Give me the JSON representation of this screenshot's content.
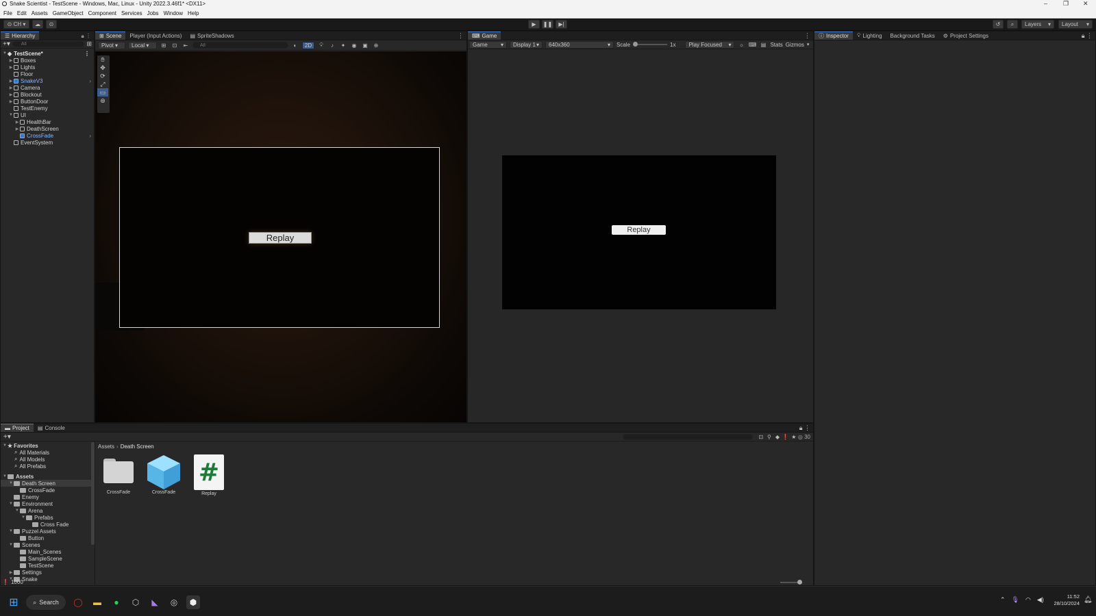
{
  "window": {
    "title": "Snake Scientist - TestScene - Windows, Mac, Linux - Unity 2022.3.46f1* <DX11>"
  },
  "menu": [
    "File",
    "Edit",
    "Assets",
    "GameObject",
    "Component",
    "Services",
    "Jobs",
    "Window",
    "Help"
  ],
  "toolbar": {
    "account": "CH",
    "layers": "Layers",
    "layout": "Layout"
  },
  "hierarchy": {
    "tab": "Hierarchy",
    "search_placeholder": "All",
    "scene": "TestScene*",
    "items": [
      {
        "label": "Boxes",
        "depth": 1,
        "arrow": "▶",
        "selected": false
      },
      {
        "label": "Lights",
        "depth": 1,
        "arrow": "▶",
        "selected": false
      },
      {
        "label": "Floor",
        "depth": 1,
        "arrow": "",
        "selected": false
      },
      {
        "label": "SnakeV3",
        "depth": 1,
        "arrow": "▶",
        "selected": true
      },
      {
        "label": "Camera",
        "depth": 1,
        "arrow": "▶",
        "selected": false
      },
      {
        "label": "Blockout",
        "depth": 1,
        "arrow": "▶",
        "selected": false
      },
      {
        "label": "ButtonDoor",
        "depth": 1,
        "arrow": "▶",
        "selected": false
      },
      {
        "label": "TestEnemy",
        "depth": 1,
        "arrow": "",
        "selected": false
      },
      {
        "label": "UI",
        "depth": 1,
        "arrow": "▼",
        "selected": false
      },
      {
        "label": "HealthBar",
        "depth": 2,
        "arrow": "▶",
        "selected": false
      },
      {
        "label": "DeathScreen",
        "depth": 2,
        "arrow": "▶",
        "selected": false
      },
      {
        "label": "CrossFade",
        "depth": 2,
        "arrow": "",
        "selected": true
      },
      {
        "label": "EventSystem",
        "depth": 1,
        "arrow": "",
        "selected": false
      }
    ]
  },
  "scene_view": {
    "tabs": [
      "Scene",
      "Player (Input Actions)",
      "SpriteShadows"
    ],
    "pivot": "Pivot",
    "local": "Local",
    "search_placeholder": "All",
    "mode_2d": "2D",
    "replay_label": "Replay"
  },
  "game_view": {
    "tab": "Game",
    "mode": "Game",
    "display": "Display 1",
    "resolution": "640x360",
    "scale_label": "Scale",
    "scale_value": "1x",
    "play_mode": "Play Focused",
    "stats": "Stats",
    "gizmos": "Gizmos",
    "replay_label": "Replay"
  },
  "inspector": {
    "tabs": [
      "Inspector",
      "Lighting",
      "Background Tasks",
      "Project Settings"
    ]
  },
  "project": {
    "tabs": [
      "Project",
      "Console"
    ],
    "favorites_title": "Favorites",
    "favorites": [
      "All Materials",
      "All Models",
      "All Prefabs"
    ],
    "assets_title": "Assets",
    "tree": [
      {
        "label": "Death Screen",
        "depth": 1,
        "arrow": "▼"
      },
      {
        "label": "CrossFade",
        "depth": 2,
        "arrow": ""
      },
      {
        "label": "Enemy",
        "depth": 1,
        "arrow": ""
      },
      {
        "label": "Environment",
        "depth": 1,
        "arrow": "▼"
      },
      {
        "label": "Arena",
        "depth": 2,
        "arrow": "▼"
      },
      {
        "label": "Prefabs",
        "depth": 3,
        "arrow": "▼"
      },
      {
        "label": "Cross Fade",
        "depth": 4,
        "arrow": ""
      },
      {
        "label": "Puzzel Assets",
        "depth": 1,
        "arrow": "▼"
      },
      {
        "label": "Button",
        "depth": 2,
        "arrow": ""
      },
      {
        "label": "Scenes",
        "depth": 1,
        "arrow": "▼"
      },
      {
        "label": "Main_Scenes",
        "depth": 2,
        "arrow": ""
      },
      {
        "label": "SampleScene",
        "depth": 2,
        "arrow": ""
      },
      {
        "label": "TestScene",
        "depth": 2,
        "arrow": ""
      },
      {
        "label": "Settings",
        "depth": 1,
        "arrow": "▶"
      },
      {
        "label": "Snake",
        "depth": 1,
        "arrow": "▼"
      }
    ],
    "breadcrumb": [
      "Assets",
      "Death Screen"
    ],
    "assets": [
      {
        "label": "CrossFade",
        "kind": "folder"
      },
      {
        "label": "CrossFade",
        "kind": "prefab"
      },
      {
        "label": "Replay",
        "kind": "script"
      }
    ],
    "hidden_count": "30"
  },
  "status": {
    "text": "1000"
  },
  "taskbar": {
    "search": "Search",
    "time": "11:52",
    "date": "28/10/2024"
  },
  "colors": {
    "accent": "#3f7bd4",
    "prefab": "#6fc3f2",
    "script_hash": "#1f7a3a",
    "panel": "#282828"
  }
}
